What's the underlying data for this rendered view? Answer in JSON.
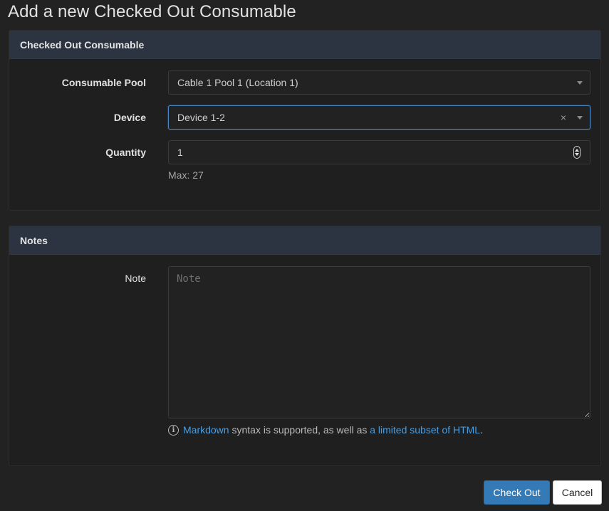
{
  "page": {
    "title": "Add a new Checked Out Consumable"
  },
  "consumable_panel": {
    "heading": "Checked Out Consumable",
    "consumable_pool": {
      "label": "Consumable Pool",
      "value": "Cable 1 Pool 1 (Location 1)"
    },
    "device": {
      "label": "Device",
      "value": "Device 1-2",
      "clear_glyph": "×"
    },
    "quantity": {
      "label": "Quantity",
      "value": "1",
      "help": "Max: 27"
    }
  },
  "notes_panel": {
    "heading": "Notes",
    "note": {
      "label": "Note",
      "placeholder": "Note",
      "value": ""
    },
    "markdown_help": {
      "link1": "Markdown",
      "middle": " syntax is supported, as well as ",
      "link2": "a limited subset of HTML",
      "end": "."
    }
  },
  "actions": {
    "submit_label": "Check Out",
    "cancel_label": "Cancel"
  },
  "colors": {
    "accent": "#337ab7",
    "link": "#4a9de0",
    "panel_heading": "#2b3440",
    "background": "#222222"
  }
}
